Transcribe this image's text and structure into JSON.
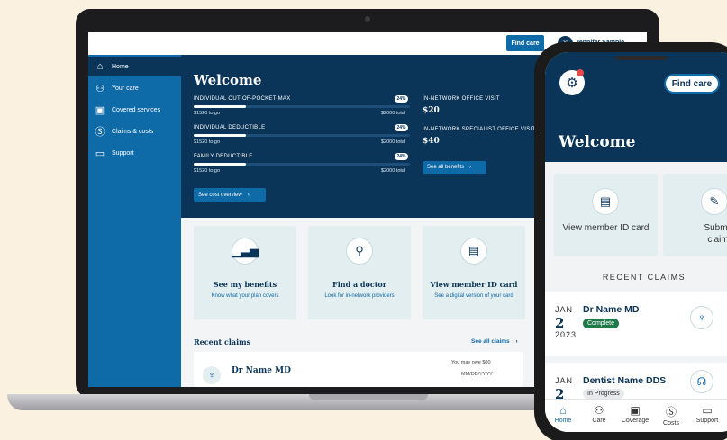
{
  "laptop": {
    "topbar": {
      "find_care": "Find care",
      "avatar_initials": "JS",
      "user_name": "Jennifer Sample"
    },
    "sidebar": {
      "items": [
        {
          "label": "Home",
          "icon": "home-icon"
        },
        {
          "label": "Your care",
          "icon": "people-icon"
        },
        {
          "label": "Covered services",
          "icon": "briefcase-icon"
        },
        {
          "label": "Claims & costs",
          "icon": "dollar-icon"
        },
        {
          "label": "Support",
          "icon": "chat-icon"
        }
      ]
    },
    "hero": {
      "title": "Welcome",
      "bars": [
        {
          "label": "INDIVIDUAL OUT-OF-POCKET-MAX",
          "pct": "24%",
          "progress": 0.24,
          "to_go": "$1520 to go",
          "total": "$2000 total"
        },
        {
          "label": "INDIVIDUAL DEDUCTIBLE",
          "pct": "24%",
          "progress": 0.24,
          "to_go": "$1520 to go",
          "total": "$2000 total"
        },
        {
          "label": "FAMILY DEDUCTIBLE",
          "pct": "24%",
          "progress": 0.24,
          "to_go": "$1520 to go",
          "total": "$2000 total"
        }
      ],
      "cost_overview": "See cost overview",
      "visits": [
        {
          "label": "IN-NETWORK OFFICE VISIT",
          "value": "$20"
        },
        {
          "label": "IN-NETWORK SPECIALIST OFFICE VISIT",
          "value": "$40"
        }
      ],
      "all_benefits": "See all benefits"
    },
    "cards": [
      {
        "title": "See my benefits",
        "sub": "Know what your plan covers",
        "icon": "chart-icon"
      },
      {
        "title": "Find a doctor",
        "sub": "Look for in-network providers",
        "icon": "magnifier-icon"
      },
      {
        "title": "View member ID card",
        "sub": "See a digital version of your card",
        "icon": "id-card-icon"
      }
    ],
    "recent": {
      "title": "Recent claims",
      "see_all": "See all claims",
      "claim": {
        "name": "Dr Name MD",
        "owe": "You may owe $00",
        "date": "MM/DD/YYYY"
      }
    }
  },
  "phone": {
    "find_care": "Find care",
    "title": "Welcome",
    "cards": [
      {
        "text": "View member ID card",
        "icon": "id-card-icon"
      },
      {
        "text": "Submit claim",
        "icon": "submit-claim-icon"
      }
    ],
    "recent_title": "RECENT CLAIMS",
    "claims": [
      {
        "month": "JAN",
        "day": "2",
        "year": "2023",
        "name": "Dr Name MD",
        "status": "Complete",
        "icon": "stethoscope-icon"
      },
      {
        "month": "JAN",
        "day": "2",
        "year": "",
        "name": "Dentist Name DDS",
        "status": "In Progress",
        "icon": "tooth-icon"
      }
    ],
    "nav": [
      {
        "label": "Home",
        "icon": "home-icon"
      },
      {
        "label": "Care",
        "icon": "people-icon"
      },
      {
        "label": "Coverage",
        "icon": "briefcase-icon"
      },
      {
        "label": "Costs",
        "icon": "dollar-icon"
      },
      {
        "label": "Support",
        "icon": "chat-icon"
      }
    ],
    "colors": {
      "navy": "#0a3558",
      "blue": "#0f6aa8",
      "complete": "#1f7a4a",
      "progress": "#e7e9ec"
    }
  }
}
